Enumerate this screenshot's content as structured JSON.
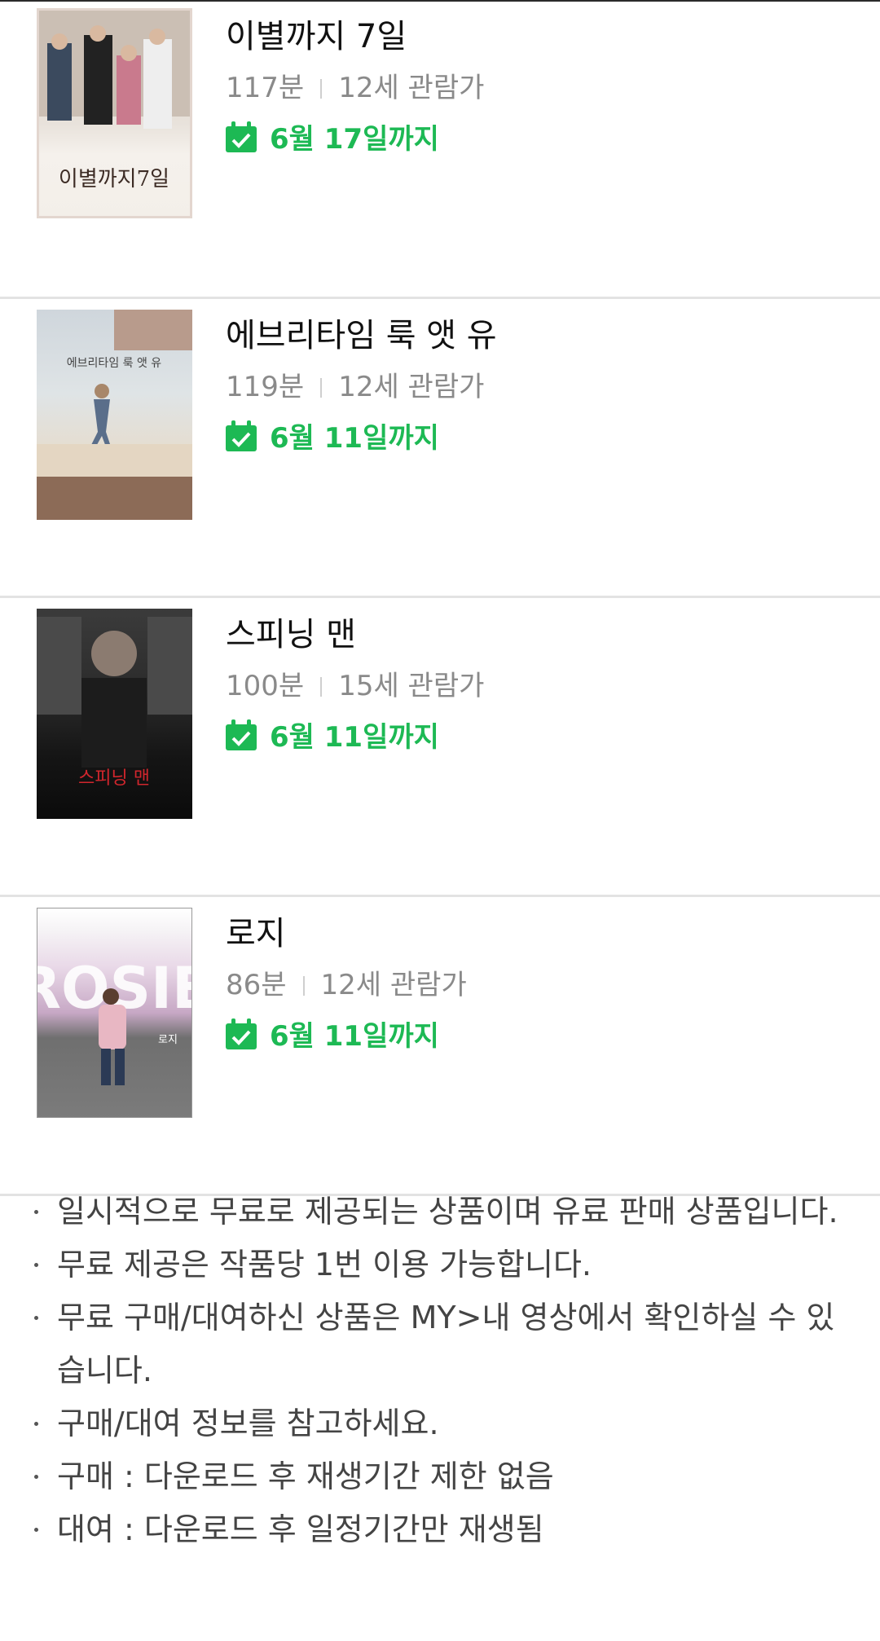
{
  "movies": [
    {
      "title": "이별까지 7일",
      "runtime": "117분",
      "rating": "12세 관람가",
      "until": "6월 17일까지",
      "poster_title": "이별까지7일"
    },
    {
      "title": "에브리타임 룩 앳 유",
      "runtime": "119분",
      "rating": "12세 관람가",
      "until": "6월 11일까지",
      "poster_title": "에브리타임 룩 앳 유"
    },
    {
      "title": "스피닝 맨",
      "runtime": "100분",
      "rating": "15세 관람가",
      "until": "6월 11일까지",
      "poster_title": "스피닝 맨"
    },
    {
      "title": "로지",
      "runtime": "86분",
      "rating": "12세 관람가",
      "until": "6월 11일까지",
      "poster_title": "ROSIE",
      "poster_subtitle": "로지"
    }
  ],
  "notes": [
    "일시적으로 무료로 제공되는 상품이며 유료 판매 상품입니다.",
    "무료 제공은 작품당 1번 이용 가능합니다.",
    "무료 구매/대여하신 상품은 MY>내 영상에서 확인하실 수 있습니다.",
    "구매/대여 정보를 참고하세요.",
    "구매 : 다운로드 후 재생기간 제한 없음",
    "대여 : 다운로드 후 일정기간만 재생됨"
  ],
  "colors": {
    "accent": "#1db954",
    "meta": "#8a8a8a",
    "divider": "#e3e3e3"
  },
  "icons": {
    "until": "calendar-check-icon"
  }
}
